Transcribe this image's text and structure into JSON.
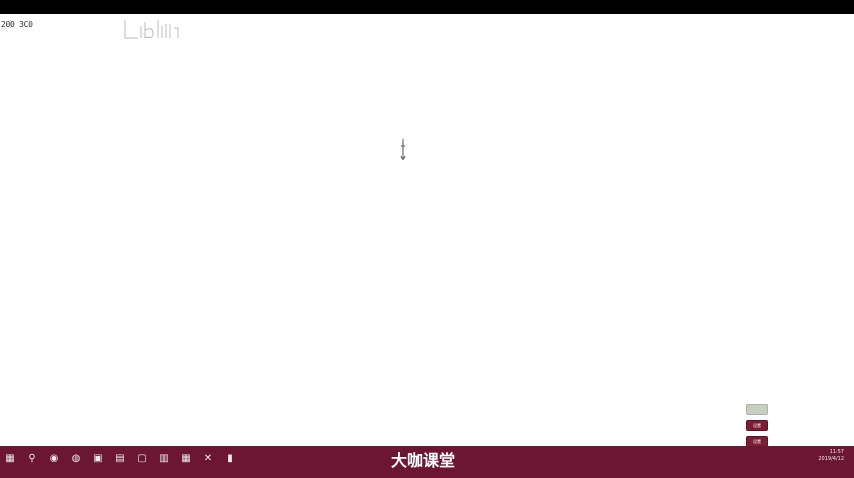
{
  "canvas": {
    "coordinate_readout": "200 3C0"
  },
  "side_widgets": {
    "buttons": [
      {
        "color": "gray",
        "label": ""
      },
      {
        "color": "red",
        "label": "设置"
      },
      {
        "color": "red",
        "label": "设置"
      }
    ]
  },
  "taskbar": {
    "background_color": "#6b1733",
    "icons": [
      "windows-start-icon",
      "search-icon",
      "chrome-icon",
      "browser-icon",
      "file-icon",
      "document-icon",
      "screen-icon",
      "folder-icon",
      "grid-icon",
      "tool-icon",
      "text-icon"
    ],
    "tray_time": "11:57",
    "tray_date": "2019/4/12"
  },
  "watermark": {
    "brand_text": "大咖课堂"
  }
}
